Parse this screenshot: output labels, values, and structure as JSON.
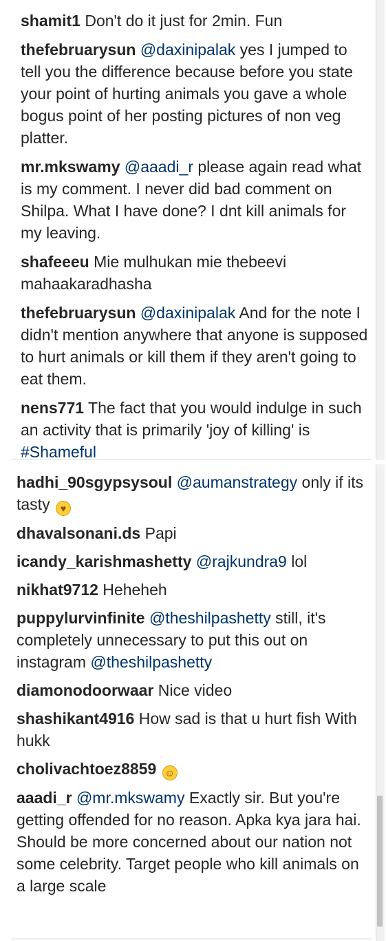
{
  "top_panel": {
    "comments": [
      {
        "user": "shamit1",
        "parts": [
          {
            "t": "text",
            "v": "Don't do it just for 2min. Fun"
          }
        ]
      },
      {
        "user": "thefebruarysun",
        "parts": [
          {
            "t": "mention",
            "v": "@daxinipalak"
          },
          {
            "t": "text",
            "v": "yes I jumped to tell you the difference because before you state your point of hurting animals you gave a whole bogus point of her posting pictures of non veg platter."
          }
        ]
      },
      {
        "user": "mr.mkswamy",
        "parts": [
          {
            "t": "mention",
            "v": "@aaadi_r"
          },
          {
            "t": "text",
            "v": "please again read what is my comment. I never did bad comment on Shilpa. What I have done? I dnt kill animals for my leaving."
          }
        ]
      },
      {
        "user": "shafeeeu",
        "parts": [
          {
            "t": "text",
            "v": "Mie mulhukan mie thebeevi mahaakaradhasha"
          }
        ]
      },
      {
        "user": "thefebruarysun",
        "parts": [
          {
            "t": "mention",
            "v": "@daxinipalak"
          },
          {
            "t": "text",
            "v": "And for the note I didn't mention anywhere that anyone is supposed to hurt animals or kill them if they aren't going to eat them."
          }
        ]
      },
      {
        "user": "nens771",
        "parts": [
          {
            "t": "text",
            "v": "The fact that you would indulge in such an activity that is primarily 'joy of killing' is"
          },
          {
            "t": "mention",
            "v": "#Shameful"
          }
        ]
      }
    ]
  },
  "bottom_panel": {
    "comments": [
      {
        "user": "hadhi_90sgypsysoul",
        "parts": [
          {
            "t": "mention",
            "v": "@aumanstrategy"
          },
          {
            "t": "text",
            "v": "only if its tasty"
          },
          {
            "t": "emoji",
            "v": "heart-eyes"
          }
        ]
      },
      {
        "user": "dhavalsonani.ds",
        "parts": [
          {
            "t": "text",
            "v": "Papi"
          }
        ]
      },
      {
        "user": "icandy_karishmashetty",
        "parts": [
          {
            "t": "mention",
            "v": "@rajkundra9"
          },
          {
            "t": "text",
            "v": "lol"
          }
        ]
      },
      {
        "user": "nikhat9712",
        "parts": [
          {
            "t": "text",
            "v": "Heheheh"
          }
        ]
      },
      {
        "user": "puppylurvinfinite",
        "parts": [
          {
            "t": "mention",
            "v": "@theshilpashetty"
          },
          {
            "t": "text",
            "v": "still, it's completely unnecessary to put this out on instagram"
          },
          {
            "t": "mention",
            "v": "@theshilpashetty"
          }
        ]
      },
      {
        "user": "diamonodoorwaar",
        "parts": [
          {
            "t": "text",
            "v": "Nice video"
          }
        ]
      },
      {
        "user": "shashikant4916",
        "parts": [
          {
            "t": "text",
            "v": "How sad is that u hurt fish With hukk"
          }
        ]
      },
      {
        "user": "cholivachtoez8859",
        "parts": [
          {
            "t": "emoji",
            "v": "smile"
          }
        ]
      },
      {
        "user": "aaadi_r",
        "parts": [
          {
            "t": "mention",
            "v": "@mr.mkswamy"
          },
          {
            "t": "text",
            "v": "Exactly sir. But you're getting offended for no reason. Apka kya jara hai. Should be more concerned about our nation not some celebrity. Target people who kill animals on a large scale"
          }
        ]
      }
    ]
  }
}
